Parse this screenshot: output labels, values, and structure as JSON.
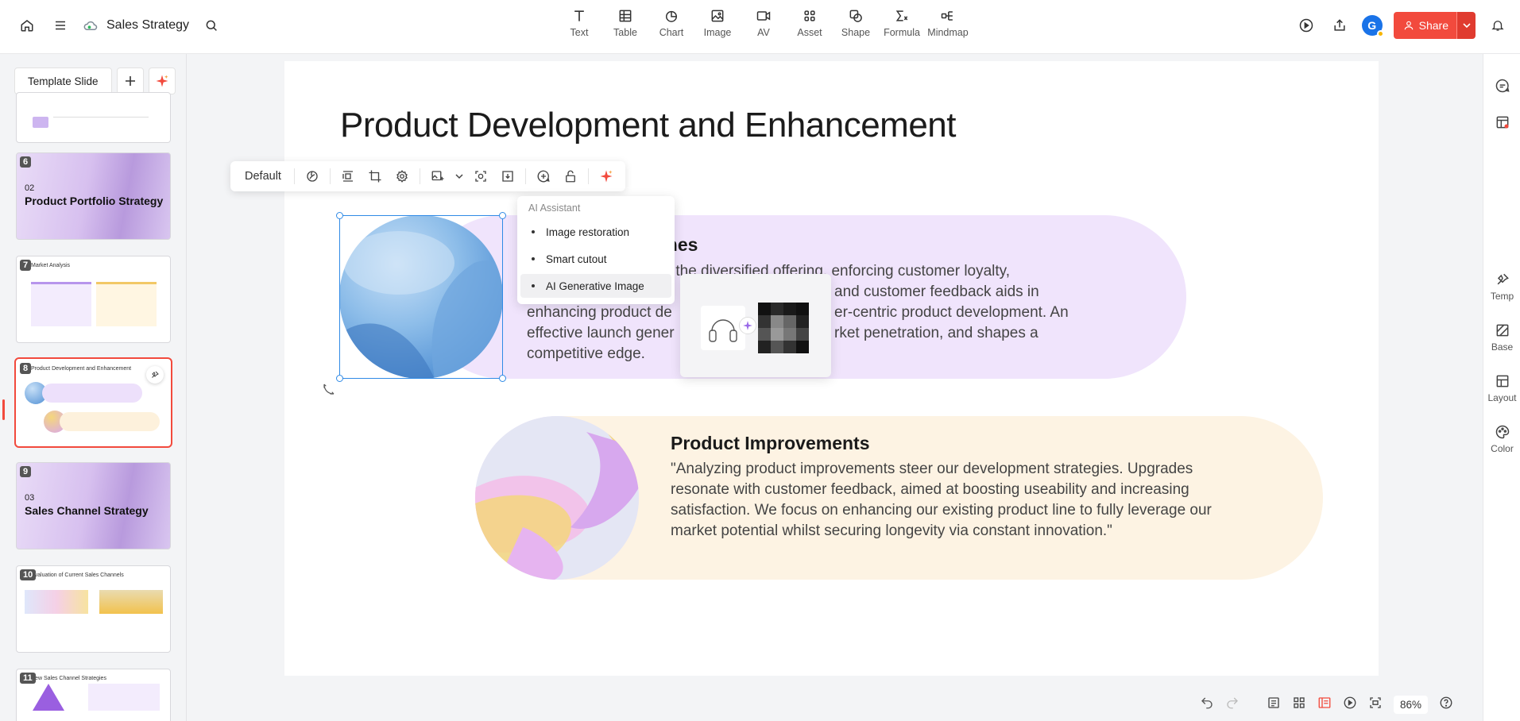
{
  "app": {
    "doc_title": "Sales Strategy"
  },
  "toolbar": {
    "tools": [
      {
        "label": "Text",
        "icon": "text-icon"
      },
      {
        "label": "Table",
        "icon": "table-icon"
      },
      {
        "label": "Chart",
        "icon": "chart-icon"
      },
      {
        "label": "Image",
        "icon": "image-icon"
      },
      {
        "label": "AV",
        "icon": "video-icon"
      },
      {
        "label": "Asset",
        "icon": "asset-icon"
      },
      {
        "label": "Shape",
        "icon": "shape-icon"
      },
      {
        "label": "Formula",
        "icon": "formula-icon"
      },
      {
        "label": "Mindmap",
        "icon": "mindmap-icon"
      }
    ],
    "avatar_letter": "G",
    "share_label": "Share"
  },
  "sidebar": {
    "template_label": "Template Slide",
    "slides": [
      {
        "num": "6",
        "sec_num": "02",
        "sec_title": "Product Portfolio Strategy"
      },
      {
        "num": "7",
        "mini_title": "Market Analysis"
      },
      {
        "num": "8",
        "mini_title": "Product Development and Enhancement"
      },
      {
        "num": "9",
        "sec_num": "03",
        "sec_title": "Sales Channel Strategy"
      },
      {
        "num": "10",
        "mini_title": "Evaluation of Current Sales Channels"
      },
      {
        "num": "11",
        "mini_title": "New Sales Channel Strategies"
      }
    ]
  },
  "slide": {
    "title": "Product Development and Enhancement",
    "card1": {
      "heading": "New Product Launches",
      "body": "New product launches bolster the diversified offering, enforcing customer loyalty. Researching market trends and customer feedback aids in enhancing product designs for customer-centric product development. An effective launch generates buzz, market penetration, and shapes a competitive edge.",
      "visible_heading": "ches",
      "visible_lines": [
        "ts bolster the diversified offering, enforcing customer loyalty,",
        "and customer feedback aids in",
        "enhancing product de",
        "er-centric product development. An",
        "effective launch gener",
        "rket penetration, and shapes a",
        "competitive edge."
      ]
    },
    "card2": {
      "heading": "Product Improvements",
      "body": "\"Analyzing product improvements steer our development strategies. Upgrades resonate with customer feedback, aimed at boosting useability and increasing satisfaction. We focus on enhancing our existing product line to fully leverage our market potential whilst securing longevity via constant innovation.\""
    }
  },
  "float_toolbar": {
    "style_label": "Default"
  },
  "ai_menu": {
    "header": "AI Assistant",
    "items": [
      "Image restoration",
      "Smart cutout",
      "AI Generative Image"
    ]
  },
  "right_rail": [
    {
      "label": "Temp",
      "icon": "pin-icon"
    },
    {
      "label": "Base",
      "icon": "base-icon"
    },
    {
      "label": "Layout",
      "icon": "layout-icon"
    },
    {
      "label": "Color",
      "icon": "palette-icon"
    }
  ],
  "bottom": {
    "zoom": "86%"
  },
  "colors": {
    "accent": "#f24a3d",
    "selection": "#2f8ae6",
    "card1_bg": "#f0e4fc",
    "card2_bg": "#fdf3e3"
  }
}
